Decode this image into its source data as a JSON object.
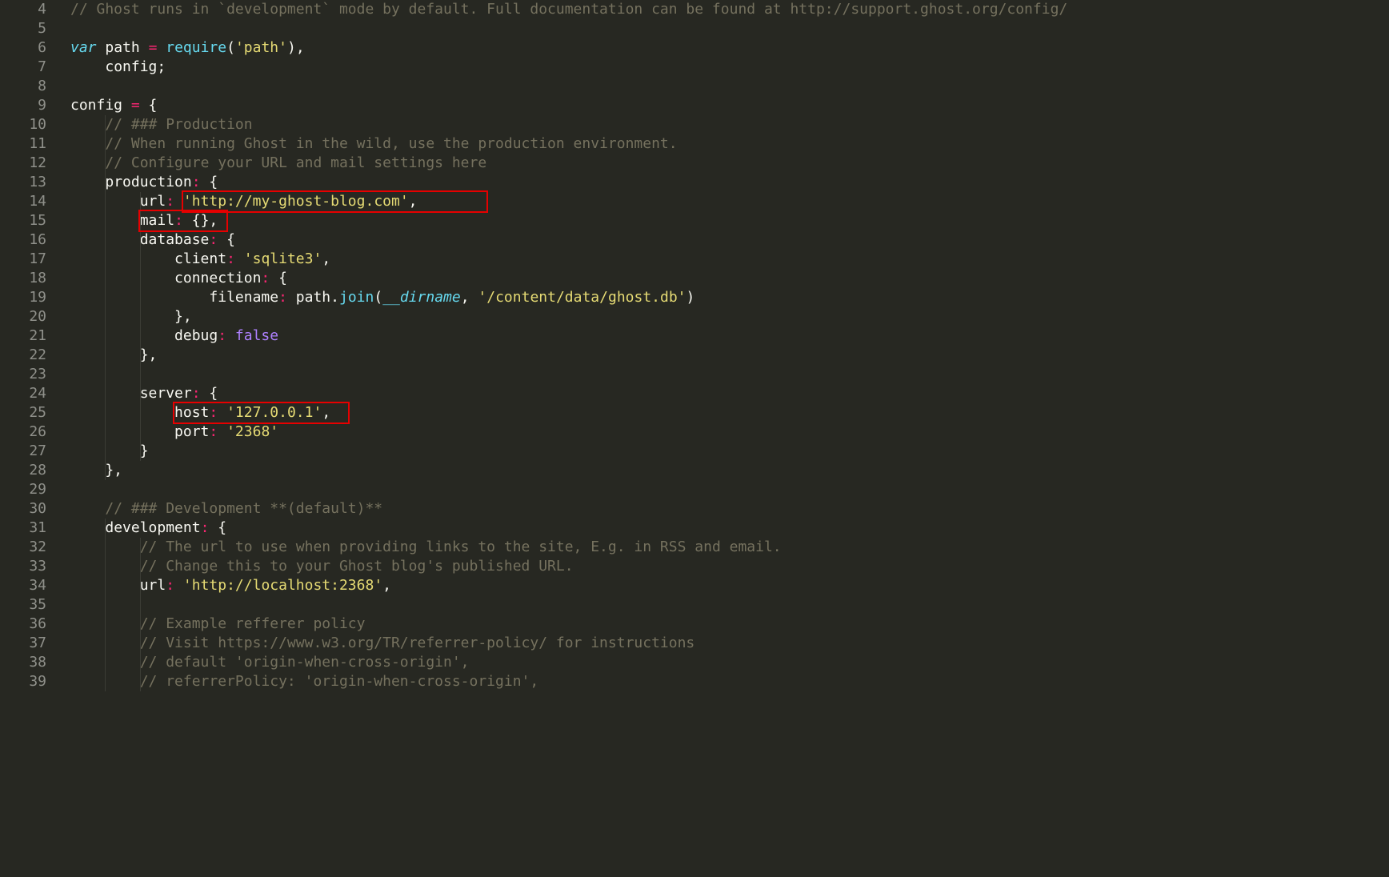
{
  "lineStart": 4,
  "lines": [
    [
      [
        "comment",
        "// Ghost runs in `development` mode by default. Full documentation can be found at http://support.ghost.org/config/"
      ]
    ],
    [],
    [
      [
        "storage",
        "var"
      ],
      [
        "punct",
        " "
      ],
      [
        "ident",
        "path"
      ],
      [
        "punct",
        " "
      ],
      [
        "op",
        "="
      ],
      [
        "punct",
        " "
      ],
      [
        "func",
        "require"
      ],
      [
        "punct",
        "("
      ],
      [
        "string",
        "'path'"
      ],
      [
        "punct",
        "),"
      ]
    ],
    [
      [
        "punct",
        "    "
      ],
      [
        "ident",
        "config"
      ],
      [
        "punct",
        ";"
      ]
    ],
    [],
    [
      [
        "ident",
        "config"
      ],
      [
        "punct",
        " "
      ],
      [
        "op",
        "="
      ],
      [
        "punct",
        " {"
      ]
    ],
    [
      [
        "punct",
        "    "
      ],
      [
        "comment",
        "// ### Production"
      ]
    ],
    [
      [
        "punct",
        "    "
      ],
      [
        "comment",
        "// When running Ghost in the wild, use the production environment."
      ]
    ],
    [
      [
        "punct",
        "    "
      ],
      [
        "comment",
        "// Configure your URL and mail settings here"
      ]
    ],
    [
      [
        "punct",
        "    "
      ],
      [
        "ident",
        "production"
      ],
      [
        "op",
        ":"
      ],
      [
        "punct",
        " {"
      ]
    ],
    [
      [
        "punct",
        "        "
      ],
      [
        "ident",
        "url"
      ],
      [
        "op",
        ":"
      ],
      [
        "punct",
        " "
      ],
      [
        "string",
        "'http://my-ghost-blog.com'"
      ],
      [
        "punct",
        ","
      ]
    ],
    [
      [
        "punct",
        "        "
      ],
      [
        "ident",
        "mail"
      ],
      [
        "op",
        ":"
      ],
      [
        "punct",
        " {},"
      ]
    ],
    [
      [
        "punct",
        "        "
      ],
      [
        "ident",
        "database"
      ],
      [
        "op",
        ":"
      ],
      [
        "punct",
        " {"
      ]
    ],
    [
      [
        "punct",
        "            "
      ],
      [
        "ident",
        "client"
      ],
      [
        "op",
        ":"
      ],
      [
        "punct",
        " "
      ],
      [
        "string",
        "'sqlite3'"
      ],
      [
        "punct",
        ","
      ]
    ],
    [
      [
        "punct",
        "            "
      ],
      [
        "ident",
        "connection"
      ],
      [
        "op",
        ":"
      ],
      [
        "punct",
        " {"
      ]
    ],
    [
      [
        "punct",
        "                "
      ],
      [
        "ident",
        "filename"
      ],
      [
        "op",
        ":"
      ],
      [
        "punct",
        " "
      ],
      [
        "ident",
        "path"
      ],
      [
        "punct",
        "."
      ],
      [
        "func",
        "join"
      ],
      [
        "punct",
        "("
      ],
      [
        "builtin",
        "__dirname"
      ],
      [
        "punct",
        ", "
      ],
      [
        "string",
        "'/content/data/ghost.db'"
      ],
      [
        "punct",
        ")"
      ]
    ],
    [
      [
        "punct",
        "            },"
      ]
    ],
    [
      [
        "punct",
        "            "
      ],
      [
        "ident",
        "debug"
      ],
      [
        "op",
        ":"
      ],
      [
        "punct",
        " "
      ],
      [
        "const",
        "false"
      ]
    ],
    [
      [
        "punct",
        "        },"
      ]
    ],
    [],
    [
      [
        "punct",
        "        "
      ],
      [
        "ident",
        "server"
      ],
      [
        "op",
        ":"
      ],
      [
        "punct",
        " {"
      ]
    ],
    [
      [
        "punct",
        "            "
      ],
      [
        "ident",
        "host"
      ],
      [
        "op",
        ":"
      ],
      [
        "punct",
        " "
      ],
      [
        "string",
        "'127.0.0.1'"
      ],
      [
        "punct",
        ","
      ]
    ],
    [
      [
        "punct",
        "            "
      ],
      [
        "ident",
        "port"
      ],
      [
        "op",
        ":"
      ],
      [
        "punct",
        " "
      ],
      [
        "string",
        "'2368'"
      ]
    ],
    [
      [
        "punct",
        "        }"
      ]
    ],
    [
      [
        "punct",
        "    },"
      ]
    ],
    [],
    [
      [
        "punct",
        "    "
      ],
      [
        "comment",
        "// ### Development **(default)**"
      ]
    ],
    [
      [
        "punct",
        "    "
      ],
      [
        "ident",
        "development"
      ],
      [
        "op",
        ":"
      ],
      [
        "punct",
        " {"
      ]
    ],
    [
      [
        "punct",
        "        "
      ],
      [
        "comment",
        "// The url to use when providing links to the site, E.g. in RSS and email."
      ]
    ],
    [
      [
        "punct",
        "        "
      ],
      [
        "comment",
        "// Change this to your Ghost blog's published URL."
      ]
    ],
    [
      [
        "punct",
        "        "
      ],
      [
        "ident",
        "url"
      ],
      [
        "op",
        ":"
      ],
      [
        "punct",
        " "
      ],
      [
        "string",
        "'http://localhost:2368'"
      ],
      [
        "punct",
        ","
      ]
    ],
    [],
    [
      [
        "punct",
        "        "
      ],
      [
        "comment",
        "// Example refferer policy"
      ]
    ],
    [
      [
        "punct",
        "        "
      ],
      [
        "comment",
        "// Visit https://www.w3.org/TR/referrer-policy/ for instructions"
      ]
    ],
    [
      [
        "punct",
        "        "
      ],
      [
        "comment",
        "// default 'origin-when-cross-origin',"
      ]
    ],
    [
      [
        "punct",
        "        "
      ],
      [
        "comment",
        "// referrerPolicy: 'origin-when-cross-origin',"
      ]
    ]
  ],
  "indentGuides": [
    {
      "fromLine": 10,
      "toLine": 28,
      "col": 4
    },
    {
      "fromLine": 14,
      "toLine": 27,
      "col": 8
    },
    {
      "fromLine": 31,
      "toLine": 39,
      "col": 4
    },
    {
      "fromLine": 32,
      "toLine": 39,
      "col": 8
    }
  ],
  "highlights": [
    {
      "line": 14,
      "startCol": 13,
      "endCol": 47
    },
    {
      "line": 15,
      "startCol": 8,
      "endCol": 17
    },
    {
      "line": 25,
      "startCol": 12,
      "endCol": 31
    }
  ]
}
